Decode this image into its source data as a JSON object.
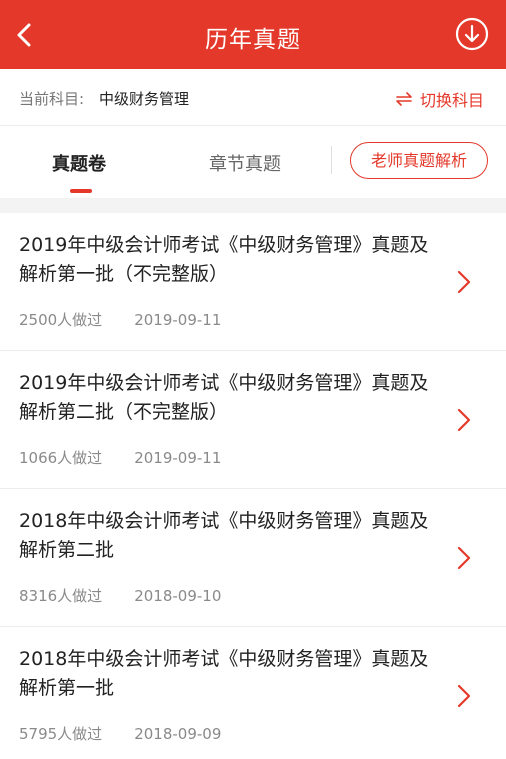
{
  "header": {
    "title": "历年真题",
    "back_icon": "back-arrow-icon",
    "download_icon": "download-circle-icon",
    "background": "#e4392a"
  },
  "subject": {
    "label": "当前科目:",
    "value": "中级财务管理",
    "switch_label": "切换科目",
    "switch_icon": "swap-arrows-icon"
  },
  "tabs": {
    "papers": "真题卷",
    "chapters": "章节真题",
    "teacher": "老师真题解析",
    "active": "papers"
  },
  "papers": [
    {
      "title": "2019年中级会计师考试《中级财务管理》真题及解析第一批（不完整版）",
      "count": "2500人做过",
      "date": "2019-09-11"
    },
    {
      "title": "2019年中级会计师考试《中级财务管理》真题及解析第二批（不完整版）",
      "count": "1066人做过",
      "date": "2019-09-11"
    },
    {
      "title": "2018年中级会计师考试《中级财务管理》真题及解析第二批",
      "count": "8316人做过",
      "date": "2018-09-10"
    },
    {
      "title": "2018年中级会计师考试《中级财务管理》真题及解析第一批",
      "count": "5795人做过",
      "date": "2018-09-09"
    }
  ],
  "colors": {
    "accent": "#e4392a"
  }
}
